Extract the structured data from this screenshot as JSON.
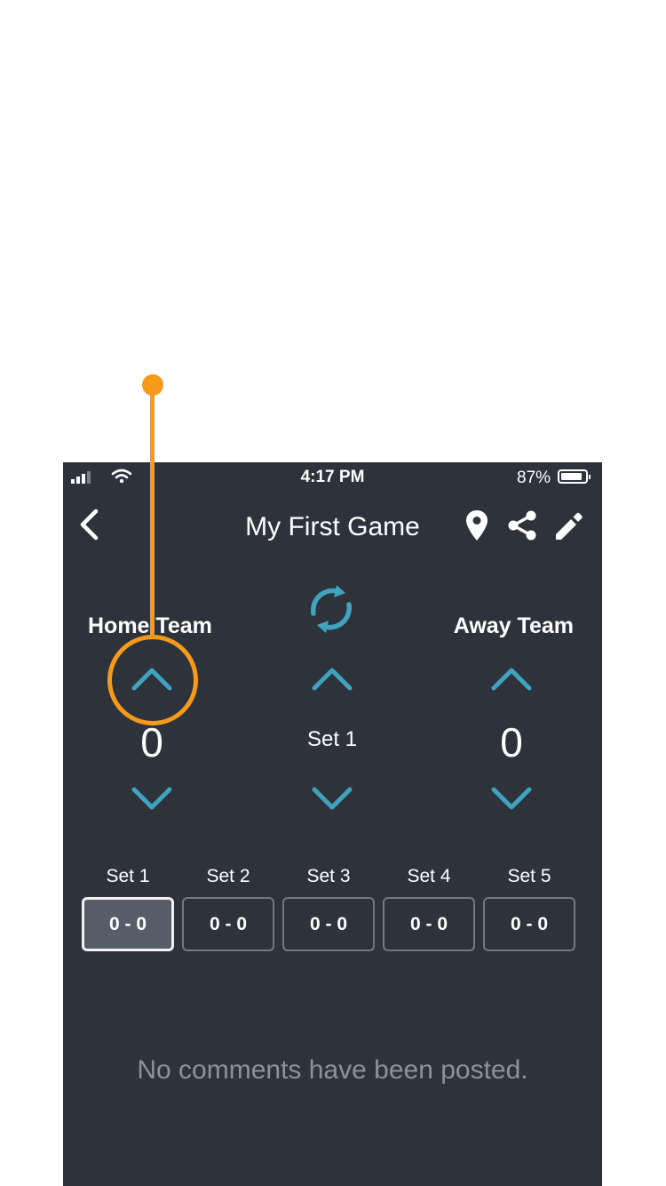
{
  "status_bar": {
    "time": "4:17 PM",
    "battery_percent": "87%",
    "battery_level": 0.87
  },
  "nav": {
    "title": "My First Game",
    "back_icon": "chevron-left-icon",
    "location_icon": "map-pin-icon",
    "share_icon": "share-icon",
    "edit_icon": "pencil-icon"
  },
  "scoreboard": {
    "home": {
      "label": "Home Team",
      "score": "0"
    },
    "away": {
      "label": "Away Team",
      "score": "0"
    },
    "current_set": "Set 1",
    "swap_icon": "swap-sides-icon"
  },
  "sets": [
    {
      "label": "Set 1",
      "score": "0 - 0",
      "active": true
    },
    {
      "label": "Set 2",
      "score": "0 - 0",
      "active": false
    },
    {
      "label": "Set 3",
      "score": "0 - 0",
      "active": false
    },
    {
      "label": "Set 4",
      "score": "0 - 0",
      "active": false
    },
    {
      "label": "Set 5",
      "score": "0 - 0",
      "active": false
    }
  ],
  "comments": {
    "empty_text": "No comments have been posted."
  },
  "colors": {
    "background": "#2e323b",
    "accent": "#3fa3bd",
    "annotation": "#f59a1b",
    "muted_text": "#8c919c"
  }
}
